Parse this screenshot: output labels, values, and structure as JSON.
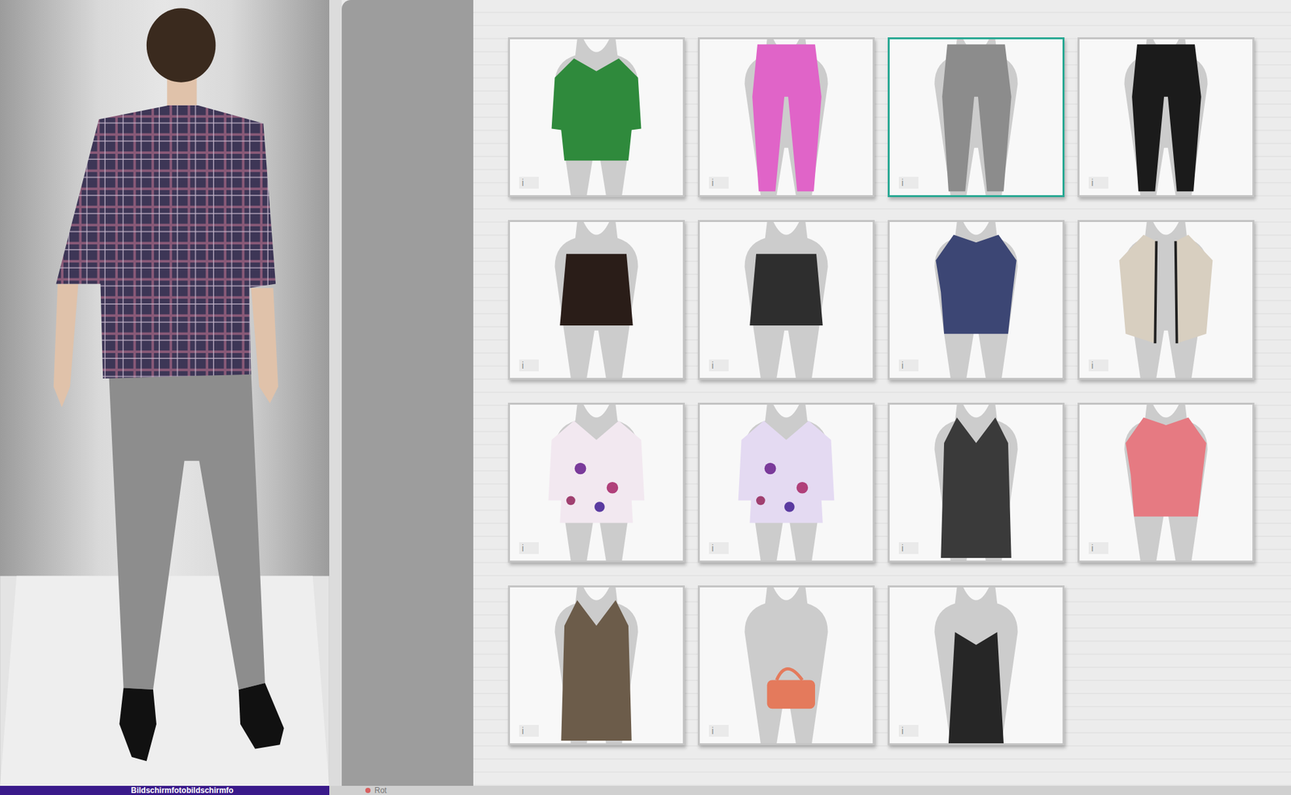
{
  "items": [
    {
      "kind": "shirt",
      "color": "#2f8a3c",
      "info": "i",
      "selected": false
    },
    {
      "kind": "pants",
      "color": "#e064c8",
      "info": "i",
      "selected": false
    },
    {
      "kind": "pants",
      "color": "#8c8c8c",
      "info": "i",
      "selected": true
    },
    {
      "kind": "pants",
      "color": "#1b1b1b",
      "info": "i",
      "selected": false
    },
    {
      "kind": "skirt",
      "color": "#2a1d18",
      "info": "i",
      "selected": false
    },
    {
      "kind": "skirt",
      "color": "#2e2e2e",
      "info": "i",
      "selected": false
    },
    {
      "kind": "top",
      "color": "#3c4674",
      "info": "i",
      "selected": false
    },
    {
      "kind": "cardigan",
      "color": "#d8cfc0",
      "info": "i",
      "selected": false
    },
    {
      "kind": "blouse",
      "color": "#f2e8f0",
      "info": "i",
      "selected": false
    },
    {
      "kind": "blouse",
      "color": "#e4daf2",
      "info": "i",
      "selected": false
    },
    {
      "kind": "dress",
      "color": "#3a3a3a",
      "info": "i",
      "selected": false
    },
    {
      "kind": "top",
      "color": "#e67a82",
      "info": "i",
      "selected": false
    },
    {
      "kind": "dress",
      "color": "#6c5c4a",
      "info": "i",
      "selected": false
    },
    {
      "kind": "bag",
      "color": "#e47a5c",
      "info": "i",
      "selected": false
    },
    {
      "kind": "slipdress",
      "color": "#262626",
      "info": "i",
      "selected": false
    }
  ],
  "taskbar": {
    "caption": "Bildschirmfotobildschirmfo",
    "tab": "Rot"
  }
}
